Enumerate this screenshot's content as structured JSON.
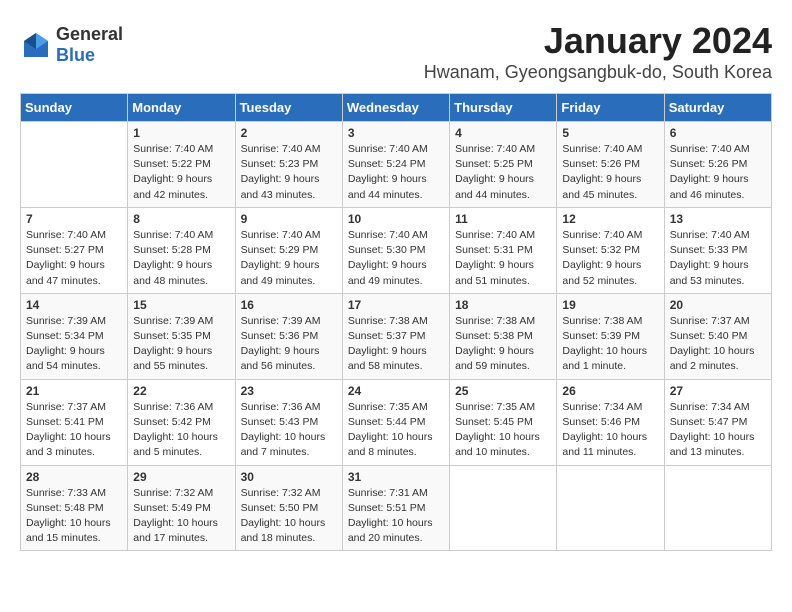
{
  "logo": {
    "text_general": "General",
    "text_blue": "Blue"
  },
  "header": {
    "title": "January 2024",
    "subtitle": "Hwanam, Gyeongsangbuk-do, South Korea"
  },
  "weekdays": [
    "Sunday",
    "Monday",
    "Tuesday",
    "Wednesday",
    "Thursday",
    "Friday",
    "Saturday"
  ],
  "weeks": [
    [
      null,
      {
        "day": 1,
        "sunrise": "7:40 AM",
        "sunset": "5:22 PM",
        "daylight": "9 hours and 42 minutes."
      },
      {
        "day": 2,
        "sunrise": "7:40 AM",
        "sunset": "5:23 PM",
        "daylight": "9 hours and 43 minutes."
      },
      {
        "day": 3,
        "sunrise": "7:40 AM",
        "sunset": "5:24 PM",
        "daylight": "9 hours and 44 minutes."
      },
      {
        "day": 4,
        "sunrise": "7:40 AM",
        "sunset": "5:25 PM",
        "daylight": "9 hours and 44 minutes."
      },
      {
        "day": 5,
        "sunrise": "7:40 AM",
        "sunset": "5:26 PM",
        "daylight": "9 hours and 45 minutes."
      },
      {
        "day": 6,
        "sunrise": "7:40 AM",
        "sunset": "5:26 PM",
        "daylight": "9 hours and 46 minutes."
      }
    ],
    [
      {
        "day": 7,
        "sunrise": "7:40 AM",
        "sunset": "5:27 PM",
        "daylight": "9 hours and 47 minutes."
      },
      {
        "day": 8,
        "sunrise": "7:40 AM",
        "sunset": "5:28 PM",
        "daylight": "9 hours and 48 minutes."
      },
      {
        "day": 9,
        "sunrise": "7:40 AM",
        "sunset": "5:29 PM",
        "daylight": "9 hours and 49 minutes."
      },
      {
        "day": 10,
        "sunrise": "7:40 AM",
        "sunset": "5:30 PM",
        "daylight": "9 hours and 49 minutes."
      },
      {
        "day": 11,
        "sunrise": "7:40 AM",
        "sunset": "5:31 PM",
        "daylight": "9 hours and 51 minutes."
      },
      {
        "day": 12,
        "sunrise": "7:40 AM",
        "sunset": "5:32 PM",
        "daylight": "9 hours and 52 minutes."
      },
      {
        "day": 13,
        "sunrise": "7:40 AM",
        "sunset": "5:33 PM",
        "daylight": "9 hours and 53 minutes."
      }
    ],
    [
      {
        "day": 14,
        "sunrise": "7:39 AM",
        "sunset": "5:34 PM",
        "daylight": "9 hours and 54 minutes."
      },
      {
        "day": 15,
        "sunrise": "7:39 AM",
        "sunset": "5:35 PM",
        "daylight": "9 hours and 55 minutes."
      },
      {
        "day": 16,
        "sunrise": "7:39 AM",
        "sunset": "5:36 PM",
        "daylight": "9 hours and 56 minutes."
      },
      {
        "day": 17,
        "sunrise": "7:38 AM",
        "sunset": "5:37 PM",
        "daylight": "9 hours and 58 minutes."
      },
      {
        "day": 18,
        "sunrise": "7:38 AM",
        "sunset": "5:38 PM",
        "daylight": "9 hours and 59 minutes."
      },
      {
        "day": 19,
        "sunrise": "7:38 AM",
        "sunset": "5:39 PM",
        "daylight": "10 hours and 1 minute."
      },
      {
        "day": 20,
        "sunrise": "7:37 AM",
        "sunset": "5:40 PM",
        "daylight": "10 hours and 2 minutes."
      }
    ],
    [
      {
        "day": 21,
        "sunrise": "7:37 AM",
        "sunset": "5:41 PM",
        "daylight": "10 hours and 3 minutes."
      },
      {
        "day": 22,
        "sunrise": "7:36 AM",
        "sunset": "5:42 PM",
        "daylight": "10 hours and 5 minutes."
      },
      {
        "day": 23,
        "sunrise": "7:36 AM",
        "sunset": "5:43 PM",
        "daylight": "10 hours and 7 minutes."
      },
      {
        "day": 24,
        "sunrise": "7:35 AM",
        "sunset": "5:44 PM",
        "daylight": "10 hours and 8 minutes."
      },
      {
        "day": 25,
        "sunrise": "7:35 AM",
        "sunset": "5:45 PM",
        "daylight": "10 hours and 10 minutes."
      },
      {
        "day": 26,
        "sunrise": "7:34 AM",
        "sunset": "5:46 PM",
        "daylight": "10 hours and 11 minutes."
      },
      {
        "day": 27,
        "sunrise": "7:34 AM",
        "sunset": "5:47 PM",
        "daylight": "10 hours and 13 minutes."
      }
    ],
    [
      {
        "day": 28,
        "sunrise": "7:33 AM",
        "sunset": "5:48 PM",
        "daylight": "10 hours and 15 minutes."
      },
      {
        "day": 29,
        "sunrise": "7:32 AM",
        "sunset": "5:49 PM",
        "daylight": "10 hours and 17 minutes."
      },
      {
        "day": 30,
        "sunrise": "7:32 AM",
        "sunset": "5:50 PM",
        "daylight": "10 hours and 18 minutes."
      },
      {
        "day": 31,
        "sunrise": "7:31 AM",
        "sunset": "5:51 PM",
        "daylight": "10 hours and 20 minutes."
      },
      null,
      null,
      null
    ]
  ]
}
